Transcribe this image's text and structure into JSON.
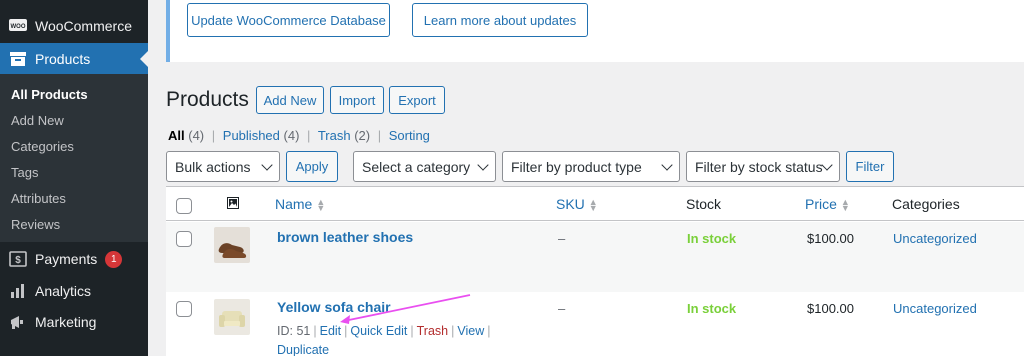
{
  "sidebar": {
    "woocommerce": "WooCommerce",
    "products": "Products",
    "submenu": [
      "All Products",
      "Add New",
      "Categories",
      "Tags",
      "Attributes",
      "Reviews"
    ],
    "payments": "Payments",
    "payments_badge": "1",
    "analytics": "Analytics",
    "marketing": "Marketing",
    "woo_logo_text": "WOO"
  },
  "notice": {
    "update_button": "Update WooCommerce Database",
    "learn_button": "Learn more about updates"
  },
  "header": {
    "title": "Products",
    "add_new": "Add New",
    "import": "Import",
    "export": "Export"
  },
  "views": {
    "all": "All",
    "all_count": "(4)",
    "published": "Published",
    "published_count": "(4)",
    "trash": "Trash",
    "trash_count": "(2)",
    "sorting": "Sorting"
  },
  "filters": {
    "bulk_actions": "Bulk actions",
    "apply": "Apply",
    "category": "Select a category",
    "product_type": "Filter by product type",
    "stock_status": "Filter by stock status",
    "filter": "Filter"
  },
  "table": {
    "columns": {
      "name": "Name",
      "sku": "SKU",
      "stock": "Stock",
      "price": "Price",
      "categories": "Categories"
    },
    "rows": [
      {
        "name": "brown leather shoes",
        "sku": "–",
        "stock": "In stock",
        "price": "$100.00",
        "category": "Uncategorized"
      },
      {
        "name": "Yellow sofa chair",
        "sku": "–",
        "stock": "In stock",
        "price": "$100.00",
        "category": "Uncategorized",
        "actions": {
          "id": "ID: 51",
          "edit": "Edit",
          "quick_edit": "Quick Edit",
          "trash": "Trash",
          "view": "View",
          "duplicate": "Duplicate"
        }
      }
    ]
  },
  "colors": {
    "accent": "#2271b1",
    "in_stock": "#7ad03a",
    "annotation_arrow": "#e94ff0"
  }
}
